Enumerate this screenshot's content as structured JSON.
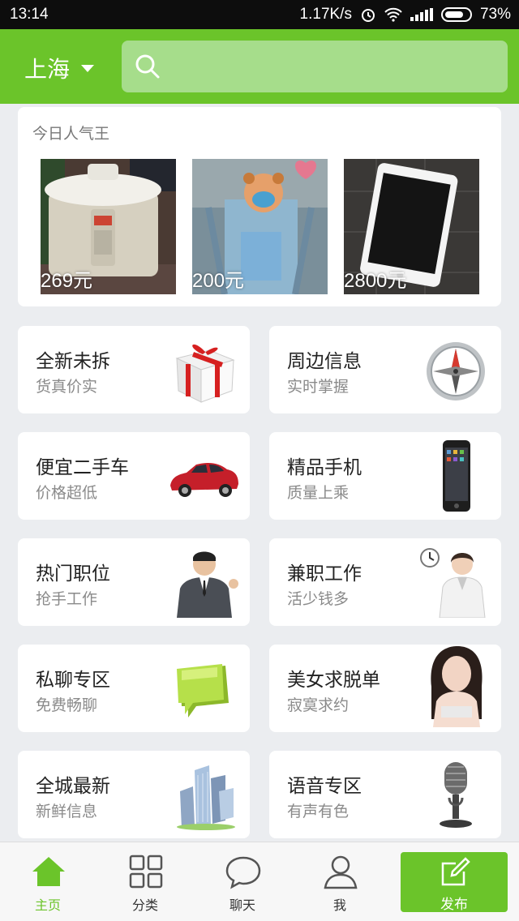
{
  "status": {
    "time": "13:14",
    "speed": "1.17K/s",
    "battery": "73%"
  },
  "header": {
    "city": "上海"
  },
  "hot": {
    "title": "今日人气王",
    "items": [
      {
        "price": "269元",
        "image": "rice-cooker"
      },
      {
        "price": "200元",
        "image": "baby-stroller"
      },
      {
        "price": "2800元",
        "image": "tablet"
      }
    ]
  },
  "categories": [
    {
      "title": "全新未拆",
      "subtitle": "货真价实",
      "icon": "gift-box-icon"
    },
    {
      "title": "周边信息",
      "subtitle": "实时掌握",
      "icon": "compass-icon"
    },
    {
      "title": "便宜二手车",
      "subtitle": "价格超低",
      "icon": "car-icon"
    },
    {
      "title": "精品手机",
      "subtitle": "质量上乘",
      "icon": "phone-icon"
    },
    {
      "title": "热门职位",
      "subtitle": "抢手工作",
      "icon": "businessman-icon"
    },
    {
      "title": "兼职工作",
      "subtitle": "活少钱多",
      "icon": "clerk-icon"
    },
    {
      "title": "私聊专区",
      "subtitle": "免费畅聊",
      "icon": "chat-bubble-icon"
    },
    {
      "title": "美女求脱单",
      "subtitle": "寂寞求约",
      "icon": "woman-icon"
    },
    {
      "title": "全城最新",
      "subtitle": "新鲜信息",
      "icon": "buildings-icon"
    },
    {
      "title": "语音专区",
      "subtitle": "有声有色",
      "icon": "microphone-icon"
    }
  ],
  "nav": {
    "home": "主页",
    "category": "分类",
    "chat": "聊天",
    "me": "我",
    "publish": "发布"
  },
  "colors": {
    "brand": "#6bc42a",
    "search_bg": "#a6dd8b",
    "page_bg": "#ebedf0"
  }
}
